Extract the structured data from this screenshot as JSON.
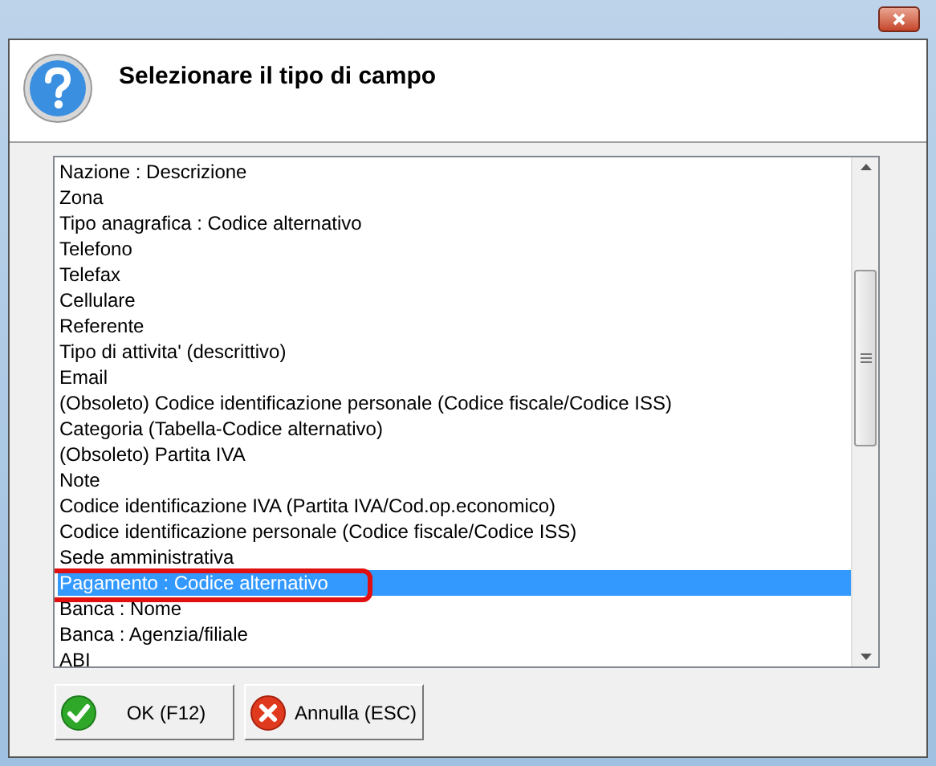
{
  "dialog": {
    "title": "Selezionare il tipo di campo"
  },
  "list": {
    "items": [
      {
        "label": "Nazione : Descrizione",
        "selected": false
      },
      {
        "label": "Zona",
        "selected": false
      },
      {
        "label": "Tipo anagrafica : Codice alternativo",
        "selected": false
      },
      {
        "label": "Telefono",
        "selected": false
      },
      {
        "label": "Telefax",
        "selected": false
      },
      {
        "label": "Cellulare",
        "selected": false
      },
      {
        "label": "Referente",
        "selected": false
      },
      {
        "label": "Tipo di attivita' (descrittivo)",
        "selected": false
      },
      {
        "label": "Email",
        "selected": false
      },
      {
        "label": "(Obsoleto) Codice identificazione personale (Codice fiscale/Codice ISS)",
        "selected": false
      },
      {
        "label": "Categoria (Tabella-Codice alternativo)",
        "selected": false
      },
      {
        "label": "(Obsoleto) Partita IVA",
        "selected": false
      },
      {
        "label": "Note",
        "selected": false
      },
      {
        "label": "Codice identificazione IVA (Partita IVA/Cod.op.economico)",
        "selected": false
      },
      {
        "label": "Codice identificazione personale (Codice fiscale/Codice ISS)",
        "selected": false
      },
      {
        "label": "Sede amministrativa",
        "selected": false
      },
      {
        "label": "Pagamento : Codice alternativo",
        "selected": true
      },
      {
        "label": "Banca : Nome",
        "selected": false
      },
      {
        "label": "Banca : Agenzia/filiale",
        "selected": false
      },
      {
        "label": "ABI",
        "selected": false
      }
    ]
  },
  "buttons": [
    {
      "kind": "ok",
      "label": "OK (F12)"
    },
    {
      "kind": "cancel",
      "label": "Annulla (ESC)"
    }
  ]
}
